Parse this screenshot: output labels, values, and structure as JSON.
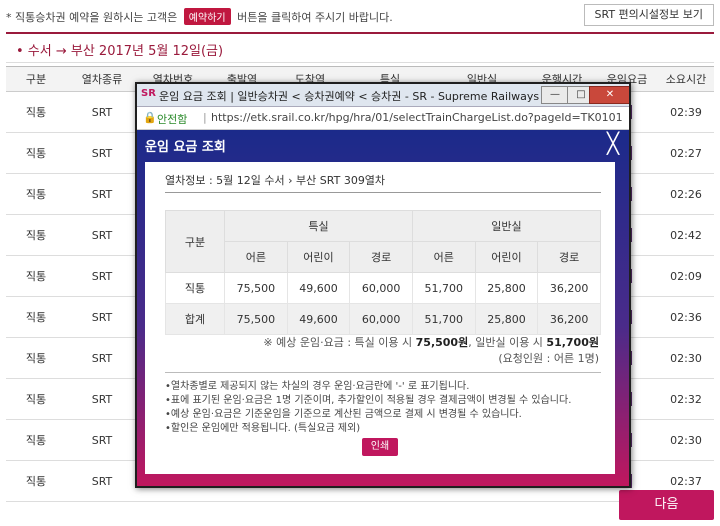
{
  "page": {
    "notice_pre": "* 직통승차권 예약을 원하시는 고객은",
    "notice_badge": "예약하기",
    "notice_post": "버튼을 클릭하여 주시기 바랍니다.",
    "srt_button": "SRT 편의시설정보 보기",
    "route": "• 수서 → 부산   2017년 5월 12일(금)",
    "table_headers": [
      "구분",
      "열차종류",
      "열차번호",
      "출발역",
      "도착역",
      "특실",
      "일반실",
      "운행시간",
      "운임요금",
      "소요시간"
    ],
    "rows": [
      {
        "type": "직통",
        "train": "SRT",
        "duration": "02:39"
      },
      {
        "type": "직통",
        "train": "SRT",
        "duration": "02:27"
      },
      {
        "type": "직통",
        "train": "SRT",
        "duration": "02:26"
      },
      {
        "type": "직통",
        "train": "SRT",
        "duration": "02:42"
      },
      {
        "type": "직통",
        "train": "SRT",
        "duration": "02:09"
      },
      {
        "type": "직통",
        "train": "SRT",
        "duration": "02:36"
      },
      {
        "type": "직통",
        "train": "SRT",
        "duration": "02:30"
      },
      {
        "type": "직통",
        "train": "SRT",
        "duration": "02:32"
      },
      {
        "type": "직통",
        "train": "SRT",
        "duration": "02:30"
      },
      {
        "type": "직통",
        "train": "SRT",
        "duration": "02:37"
      }
    ],
    "next_button": "다음"
  },
  "popup": {
    "logo": "SR",
    "window_title": "운임 요금 조회 | 일반승차권 < 승차권예약 < 승차권 - SR - Supreme Railways - Chrome",
    "controls": {
      "minimize": "—",
      "restore": "□",
      "close": "✕"
    },
    "secure_label": "안전함",
    "url": "https://etk.srail.co.kr/hpg/hra/01/selectTrainChargeList.do?pageId=TK0101010000",
    "header": "운임 요금 조회",
    "close_x": "╳",
    "train_info": "열차정보 : 5월 12일 수서    › 부산 SRT 309열차",
    "fare_table": {
      "col_group_label": "구분",
      "group_special": "특실",
      "group_general": "일반실",
      "sub_headers": [
        "어른",
        "어린이",
        "경로",
        "어른",
        "어린이",
        "경로"
      ],
      "rows": [
        {
          "label": "직통",
          "values": [
            "75,500",
            "49,600",
            "60,000",
            "51,700",
            "25,800",
            "36,200"
          ]
        },
        {
          "label": "합계",
          "values": [
            "75,500",
            "49,600",
            "60,000",
            "51,700",
            "25,800",
            "36,200"
          ]
        }
      ]
    },
    "summary_pre": "※ 예상 운임·요금 : 특실 이용 시 ",
    "summary_special": "75,500원",
    "summary_mid": ", 일반실 이용 시 ",
    "summary_general": "51,700원",
    "summary_count": "(요청인원 : 어른 1명)",
    "notes": [
      "열차종별로 제공되지 않는 차실의 경우 운임·요금란에 '-' 로 표기됩니다.",
      "표에 표기된 운임·요금은 1명 기준이며, 추가할인이 적용될 경우 결제금액이 변경될 수 있습니다.",
      "예상 운임·요금은 기준운임을 기준으로 계산된 금액으로 결제 시 변경될 수 있습니다.",
      "할인은 운임에만 적용됩니다. (특실요금 제외)"
    ],
    "print_button": "인쇄"
  }
}
